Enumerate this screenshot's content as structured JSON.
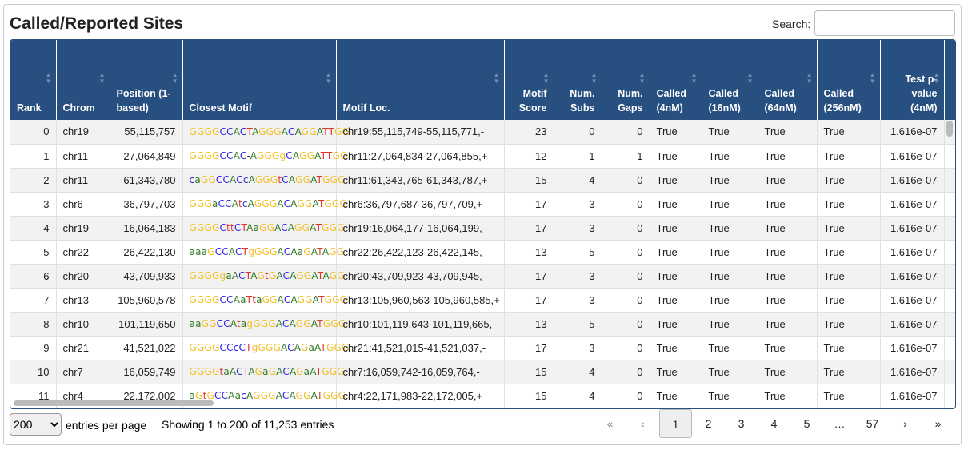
{
  "title": "Called/Reported Sites",
  "search": {
    "label": "Search:",
    "value": ""
  },
  "columns": [
    "Rank",
    "Chrom",
    "Position (1-based)",
    "Closest Motif",
    "Motif Loc.",
    "Motif Score",
    "Num. Subs",
    "Num. Gaps",
    "Called (4nM)",
    "Called (16nM)",
    "Called (64nM)",
    "Called (256nM)",
    "Test p-value (4nM)"
  ],
  "rows": [
    [
      "0",
      "chr19",
      "55,115,757",
      "GGGGCCACTAGGGACAGGATTGG",
      "chr19:55,115,749-55,115,771,-",
      "23",
      "0",
      "0",
      "True",
      "True",
      "True",
      "True",
      "1.616e-07"
    ],
    [
      "1",
      "chr11",
      "27,064,849",
      "GGGGCCAC-AGGGgCAGGATTGG",
      "chr11:27,064,834-27,064,855,+",
      "12",
      "1",
      "1",
      "True",
      "True",
      "True",
      "True",
      "1.616e-07"
    ],
    [
      "2",
      "chr11",
      "61,343,780",
      "caGGCCACcAGGGtCAGGATGGG",
      "chr11:61,343,765-61,343,787,+",
      "15",
      "4",
      "0",
      "True",
      "True",
      "True",
      "True",
      "1.616e-07"
    ],
    [
      "3",
      "chr6",
      "36,797,703",
      "GGGaCCAtcAGGGACAGGATGGG",
      "chr6:36,797,687-36,797,709,+",
      "17",
      "3",
      "0",
      "True",
      "True",
      "True",
      "True",
      "1.616e-07"
    ],
    [
      "4",
      "chr19",
      "16,064,183",
      "GGGGCttCTAaGGACAGGATGGG",
      "chr19:16,064,177-16,064,199,-",
      "17",
      "3",
      "0",
      "True",
      "True",
      "True",
      "True",
      "1.616e-07"
    ],
    [
      "5",
      "chr22",
      "26,422,130",
      "aaaGCCACTgGGGACAaGATAGG",
      "chr22:26,422,123-26,422,145,-",
      "13",
      "5",
      "0",
      "True",
      "True",
      "True",
      "True",
      "1.616e-07"
    ],
    [
      "6",
      "chr20",
      "43,709,933",
      "GGGGgaACTAGtGACAGGATAGG",
      "chr20:43,709,923-43,709,945,-",
      "17",
      "3",
      "0",
      "True",
      "True",
      "True",
      "True",
      "1.616e-07"
    ],
    [
      "7",
      "chr13",
      "105,960,578",
      "GGGGCCAaTtaGGACAGGATGGG",
      "chr13:105,960,563-105,960,585,+",
      "17",
      "3",
      "0",
      "True",
      "True",
      "True",
      "True",
      "1.616e-07"
    ],
    [
      "8",
      "chr10",
      "101,119,650",
      "aaGGCCAtagGGGACAGGATGGG",
      "chr10:101,119,643-101,119,665,-",
      "13",
      "5",
      "0",
      "True",
      "True",
      "True",
      "True",
      "1.616e-07"
    ],
    [
      "9",
      "chr21",
      "41,521,022",
      "GGGGCCcCTgGGGACAGaATGGG",
      "chr21:41,521,015-41,521,037,-",
      "17",
      "3",
      "0",
      "True",
      "True",
      "True",
      "True",
      "1.616e-07"
    ],
    [
      "10",
      "chr7",
      "16,059,749",
      "GGGGtaACTAGaGACAGaATGGG",
      "chr7:16,059,742-16,059,764,-",
      "15",
      "4",
      "0",
      "True",
      "True",
      "True",
      "True",
      "1.616e-07"
    ],
    [
      "11",
      "chr4",
      "22,172,002",
      "aGtGCCAacAGGGACAGGATGGG",
      "chr4:22,171,983-22,172,005,+",
      "15",
      "4",
      "0",
      "True",
      "True",
      "True",
      "True",
      "1.616e-07"
    ]
  ],
  "footer": {
    "page_size": "200",
    "entries_label": "entries per page",
    "info": "Showing 1 to 200 of 11,253 entries"
  },
  "pager": [
    "«",
    "‹",
    "1",
    "2",
    "3",
    "4",
    "5",
    "…",
    "57",
    "›",
    "»"
  ],
  "colors": {
    "header": "#274f80",
    "G": "#f3bf2a",
    "C": "#2d22e0",
    "A": "#2f7a22",
    "T": "#e0342a"
  }
}
